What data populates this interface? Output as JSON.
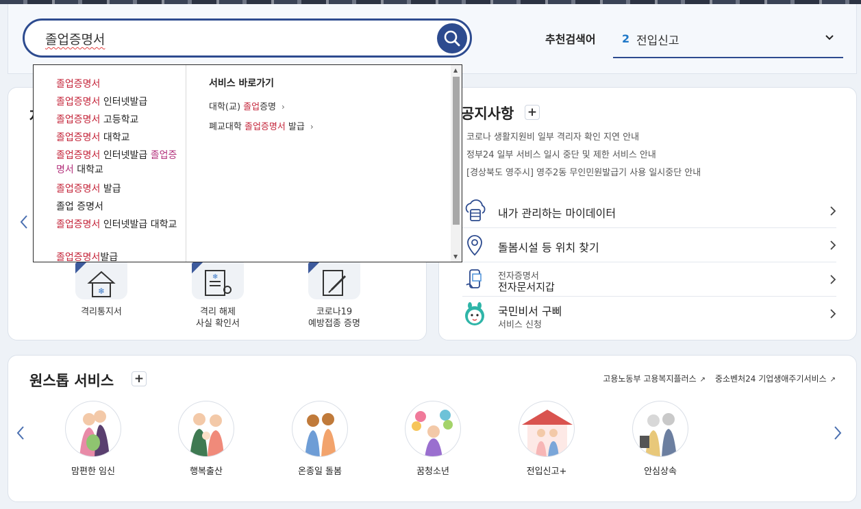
{
  "search": {
    "value": "졸업증명서",
    "recommend_label": "추천검색어",
    "recommend_rank": "2",
    "recommend_term": "전입신고"
  },
  "suggestions": {
    "items": [
      {
        "parts": [
          {
            "t": "졸업증명서",
            "c": "hl"
          }
        ]
      },
      {
        "parts": [
          {
            "t": "졸업증명서",
            "c": "hl"
          },
          {
            "t": " 인터넷발급",
            "c": ""
          }
        ]
      },
      {
        "parts": [
          {
            "t": "졸업증명서",
            "c": "hl"
          },
          {
            "t": " 고등학교",
            "c": ""
          }
        ]
      },
      {
        "parts": [
          {
            "t": "졸업증명서",
            "c": "hl"
          },
          {
            "t": " 대학교",
            "c": ""
          }
        ]
      },
      {
        "parts": [
          {
            "t": "졸업증명서",
            "c": "hl"
          },
          {
            "t": " 인터넷발급 ",
            "c": ""
          },
          {
            "t": "졸업증명서",
            "c": "hl2"
          },
          {
            "t": " 대학교",
            "c": ""
          }
        ]
      },
      {
        "parts": [
          {
            "t": "졸업증명서",
            "c": "hl"
          },
          {
            "t": " 발급",
            "c": ""
          }
        ]
      },
      {
        "parts": [
          {
            "t": "졸업 증명서",
            "c": ""
          }
        ]
      },
      {
        "parts": [
          {
            "t": "졸업증명서",
            "c": "hl"
          },
          {
            "t": " 인터넷발급 대학교",
            "c": ""
          }
        ]
      },
      {
        "parts": [
          {
            "t": "졸업증명서",
            "c": "hl"
          },
          {
            "t": "발급",
            "c": ""
          }
        ]
      }
    ],
    "services_title": "서비스 바로가기",
    "services": [
      {
        "parts": [
          {
            "t": "대학(교) ",
            "c": ""
          },
          {
            "t": "졸업",
            "c": "hl"
          },
          {
            "t": "증명",
            "c": ""
          }
        ]
      },
      {
        "parts": [
          {
            "t": "폐교대학 ",
            "c": ""
          },
          {
            "t": "졸업증명서",
            "c": "hl"
          },
          {
            "t": " 발급",
            "c": ""
          }
        ]
      }
    ]
  },
  "left_card": {
    "heading_peek": "자",
    "certs": [
      {
        "label_line1": "격리통지서",
        "label_line2": ""
      },
      {
        "label_line1": "격리 해제",
        "label_line2": "사실 확인서"
      },
      {
        "label_line1": "코로나19",
        "label_line2": "예방접종 증명"
      }
    ]
  },
  "notices": {
    "title": "공지사항",
    "items": [
      "코로나 생활지원비 일부 격리자 확인 지연 안내",
      "정부24 일부 서비스 일시 중단 및 제한 서비스 안내",
      "[경상북도 영주시] 영주2동 무인민원발급기 사용 일시중단 안내"
    ]
  },
  "quick_services": [
    {
      "title": "내가 관리하는 마이데이터",
      "sub": ""
    },
    {
      "title": "돌봄시설 등 위치 찾기",
      "sub": ""
    },
    {
      "title": "전자문서지갑",
      "sub": "전자증명서"
    },
    {
      "title": "국민비서 구삐",
      "sub": "서비스 신청"
    }
  ],
  "onestop": {
    "title": "원스톱 서비스",
    "links": [
      "고용노동부 고용복지플러스",
      "중소벤처24 기업생애주기서비스"
    ],
    "items": [
      "맘편한 임신",
      "행복출산",
      "온종일 돌봄",
      "꿈청소년",
      "전입신고+",
      "안심상속"
    ]
  },
  "colors": {
    "primary": "#2d4b8f",
    "highlight": "#c4253a",
    "highlight_alt": "#b3327c",
    "rank": "#1f78c8"
  }
}
